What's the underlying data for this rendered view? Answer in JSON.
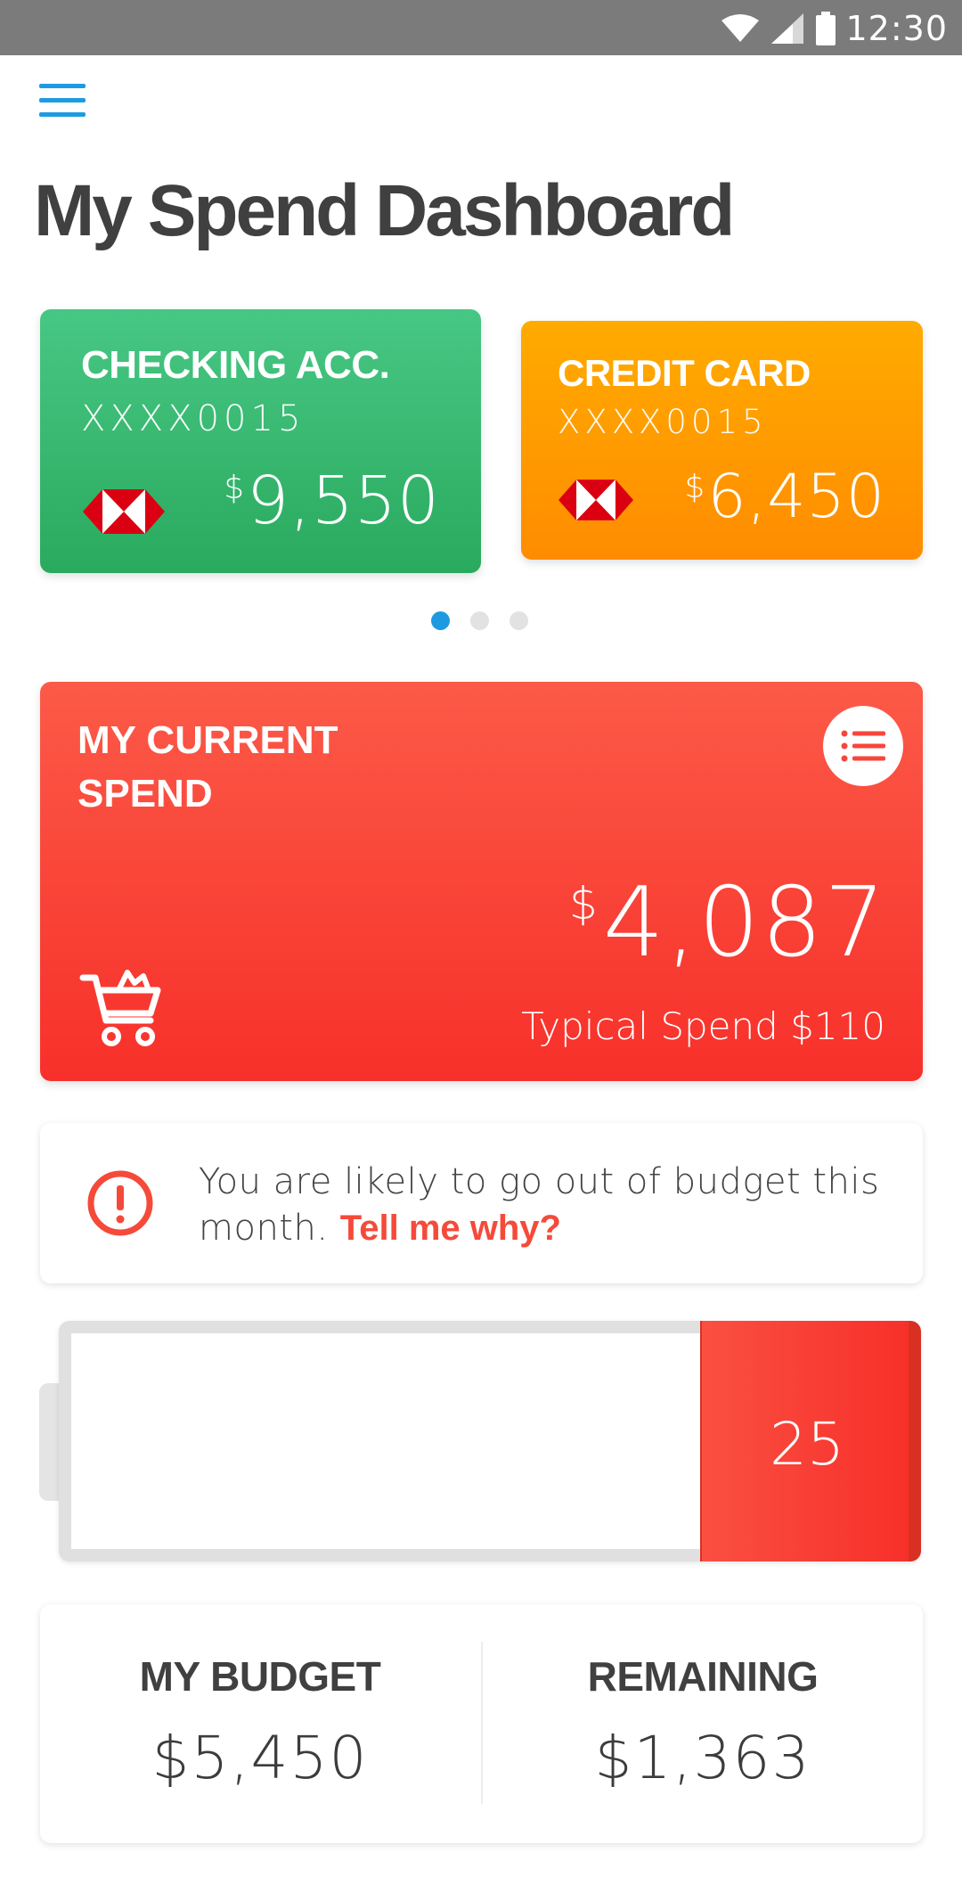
{
  "status_bar": {
    "time": "12:30"
  },
  "page": {
    "title": "My Spend Dashboard"
  },
  "accounts": [
    {
      "name": "CHECKING ACC.",
      "number": "XXXX0015",
      "currency": "$",
      "amount": "9,550",
      "color": "#3dbd74"
    },
    {
      "name": "CREDIT CARD",
      "number": "XXXX0015",
      "currency": "$",
      "amount": "6,450",
      "color": "#ff9a00"
    }
  ],
  "carousel": {
    "pages": 3,
    "active": 0
  },
  "current_spend": {
    "label": "MY CURRENT SPEND",
    "currency": "$",
    "amount": "4,087",
    "typical": "Typical Spend $110",
    "color": "#f8463a"
  },
  "alert": {
    "message": "You are likely to go out of budget this month.",
    "link": "Tell me why?",
    "color": "#f54a3a"
  },
  "battery": {
    "level": "25"
  },
  "budget": {
    "label": "MY BUDGET",
    "value": "$5,450",
    "remaining_label": "REMAINING",
    "remaining_value": "$1,363"
  },
  "colors": {
    "accent": "#1e9be0",
    "hsbc_red": "#db0011"
  }
}
